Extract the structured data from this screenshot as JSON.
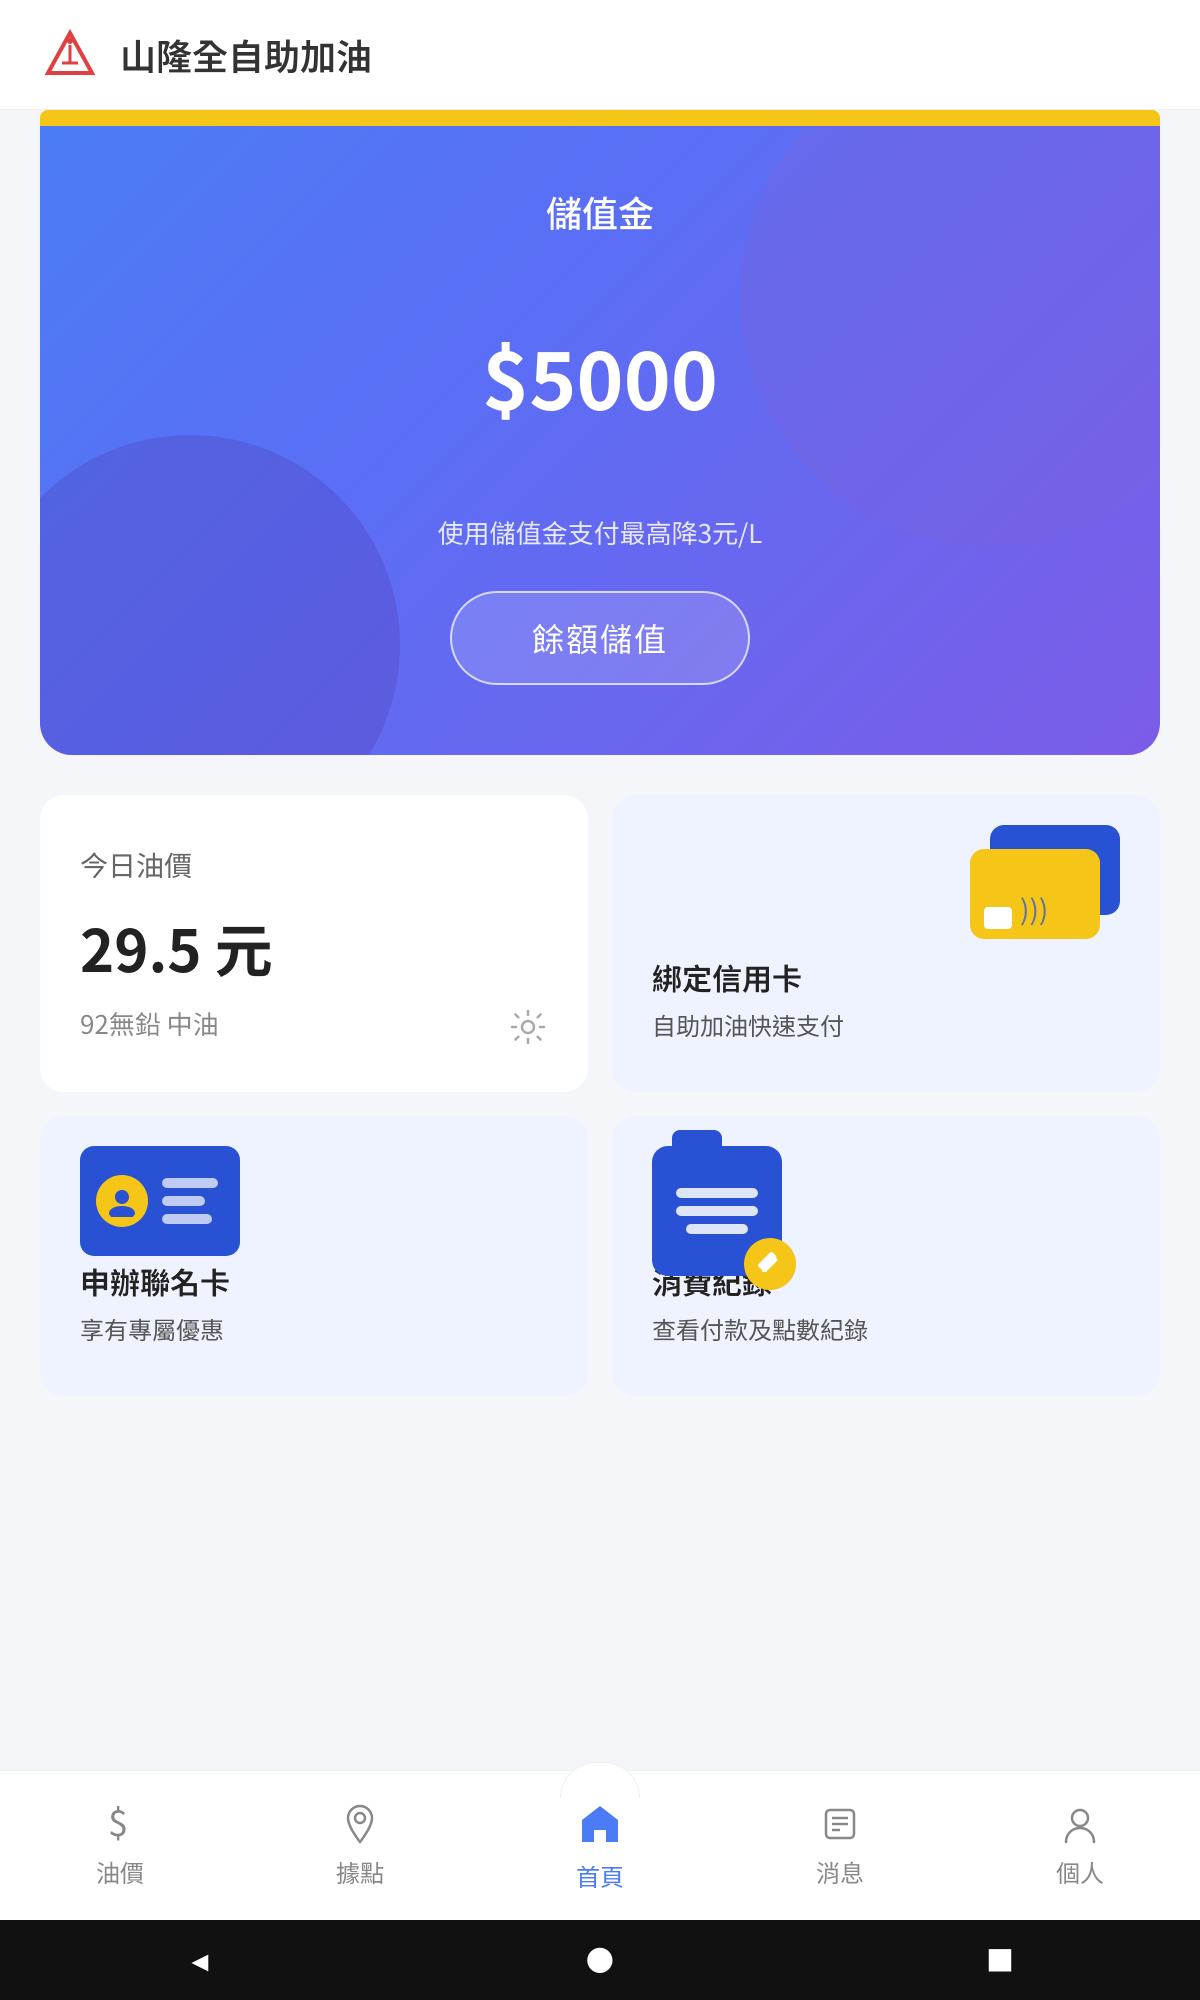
{
  "app": {
    "title": "山隆全自助加油"
  },
  "card": {
    "label": "儲值金",
    "amount": "$5000",
    "subtitle": "使用儲值金支付最高降3元/L",
    "button_label": "餘額儲值"
  },
  "oil_price": {
    "section_label": "今日油價",
    "price": "29.5 元",
    "type": "92無鉛 中油"
  },
  "credit_card": {
    "title": "綁定信用卡",
    "subtitle": "自助加油快速支付"
  },
  "member_card": {
    "title": "申辦聯名卡",
    "subtitle": "享有專屬優惠"
  },
  "record": {
    "title": "消費紀錄",
    "subtitle": "查看付款及點數紀錄"
  },
  "nav": {
    "items": [
      {
        "id": "oil",
        "label": "油價",
        "active": false
      },
      {
        "id": "points",
        "label": "據點",
        "active": false
      },
      {
        "id": "home",
        "label": "首頁",
        "active": true
      },
      {
        "id": "news",
        "label": "消息",
        "active": false
      },
      {
        "id": "profile",
        "label": "個人",
        "active": false
      }
    ]
  },
  "system_nav": {
    "back": "◄",
    "home": "●",
    "recent": "■"
  }
}
